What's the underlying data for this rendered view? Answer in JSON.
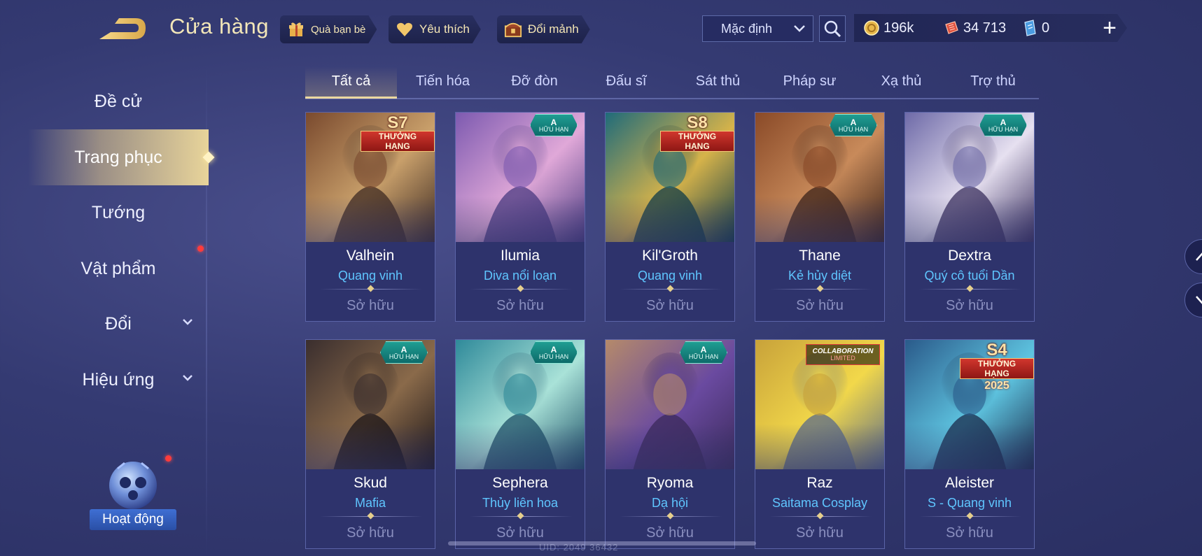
{
  "header": {
    "title": "Cửa hàng",
    "back_icon": "back-arrow-icon",
    "buttons": [
      {
        "label": "Quà bạn bè",
        "icon": "gift-icon"
      },
      {
        "label": "Yêu thích",
        "icon": "heart-icon"
      },
      {
        "label": "Đổi mảnh",
        "icon": "chest-icon"
      }
    ],
    "sort": {
      "label": "Mặc định",
      "icon": "chevron-down-icon"
    },
    "search_icon": "search-icon",
    "currencies": [
      {
        "value": "196k",
        "icon": "gold-coin-icon"
      },
      {
        "value": "34 713",
        "icon": "red-voucher-icon"
      },
      {
        "value": "0",
        "icon": "blue-voucher-icon"
      }
    ],
    "add_label": "+"
  },
  "sidebar": {
    "items": [
      {
        "label": "Đề cử"
      },
      {
        "label": "Trang phục",
        "active": true
      },
      {
        "label": "Tướng"
      },
      {
        "label": "Vật phẩm",
        "notification": true
      },
      {
        "label": "Đổi",
        "expandable": true
      },
      {
        "label": "Hiệu ứng",
        "expandable": true
      }
    ],
    "event": {
      "label": "Hoạt động",
      "notification": true
    }
  },
  "tabs": [
    {
      "label": "Tất cả",
      "active": true
    },
    {
      "label": "Tiến hóa"
    },
    {
      "label": "Đỡ đòn"
    },
    {
      "label": "Đấu sĩ"
    },
    {
      "label": "Sát thủ"
    },
    {
      "label": "Pháp sư"
    },
    {
      "label": "Xạ thủ"
    },
    {
      "label": "Trợ thủ"
    }
  ],
  "cards": [
    {
      "hero": "Valhein",
      "skin": "Quang vinh",
      "status": "Sở hữu",
      "badge": "rank",
      "season": "S7",
      "rank_label": "THƯỞNG HẠNG",
      "colors": [
        "#7a4a2e",
        "#c9a06b",
        "#3d2a22"
      ]
    },
    {
      "hero": "Ilumia",
      "skin": "Diva nổi loạn",
      "status": "Sở hữu",
      "badge": "limited",
      "badge_l1": "A",
      "badge_l2": "HỮU HẠN",
      "colors": [
        "#7d5ab0",
        "#e0a8d8",
        "#4a3a80"
      ]
    },
    {
      "hero": "Kil'Groth",
      "skin": "Quang vinh",
      "status": "Sở hữu",
      "badge": "rank",
      "season": "S8",
      "rank_label": "THƯỞNG HẠNG",
      "colors": [
        "#1f6b7a",
        "#d6b34a",
        "#0f3b48"
      ]
    },
    {
      "hero": "Thane",
      "skin": "Kẻ hủy diệt",
      "status": "Sở hữu",
      "badge": "limited",
      "badge_l1": "A",
      "badge_l2": "HỮU HẠN",
      "colors": [
        "#8a4a28",
        "#c88a5a",
        "#3b2218"
      ]
    },
    {
      "hero": "Dextra",
      "skin": "Quý cô tuổi Dần",
      "status": "Sở hữu",
      "badge": "limited",
      "badge_l1": "A",
      "badge_l2": "HỮU HẠN",
      "colors": [
        "#6e6aa8",
        "#e6e0f0",
        "#3a2f5e"
      ]
    },
    {
      "hero": "Skud",
      "skin": "Mafia",
      "status": "Sở hữu",
      "badge": "limited",
      "badge_l1": "A",
      "badge_l2": "HỮU HẠN",
      "colors": [
        "#3a2e2e",
        "#8a6a4a",
        "#1a1418"
      ]
    },
    {
      "hero": "Sephera",
      "skin": "Thủy liên hoa",
      "status": "Sở hữu",
      "badge": "limited",
      "badge_l1": "A",
      "badge_l2": "HỮU HẠN",
      "colors": [
        "#2f8a9a",
        "#a9e2d8",
        "#1c4f66"
      ]
    },
    {
      "hero": "Ryoma",
      "skin": "Dạ hội",
      "status": "Sở hữu",
      "badge": "limited",
      "badge_l1": "A",
      "badge_l2": "HỮU HẠN",
      "colors": [
        "#b58a6a",
        "#6a4aa0",
        "#3b2a5a"
      ]
    },
    {
      "hero": "Raz",
      "skin": "Saitama Cosplay",
      "status": "Sở hữu",
      "badge": "collab",
      "collab_l1": "COLLABORATION",
      "collab_l2": "LIMITED",
      "colors": [
        "#c8a23a",
        "#f2d84a",
        "#5a6a8a"
      ]
    },
    {
      "hero": "Aleister",
      "skin": "S - Quang vinh",
      "status": "Sở hữu",
      "badge": "rank",
      "season": "S4",
      "rank_label": "THƯỞNG HẠNG",
      "year": "2025",
      "colors": [
        "#2a5a8a",
        "#5ec4e0",
        "#1a2a4a"
      ]
    }
  ],
  "footer": {
    "uid": "UID: 2049  36432"
  },
  "scroll": {
    "up_icon": "chevron-up-icon",
    "down_icon": "chevron-down-icon"
  }
}
